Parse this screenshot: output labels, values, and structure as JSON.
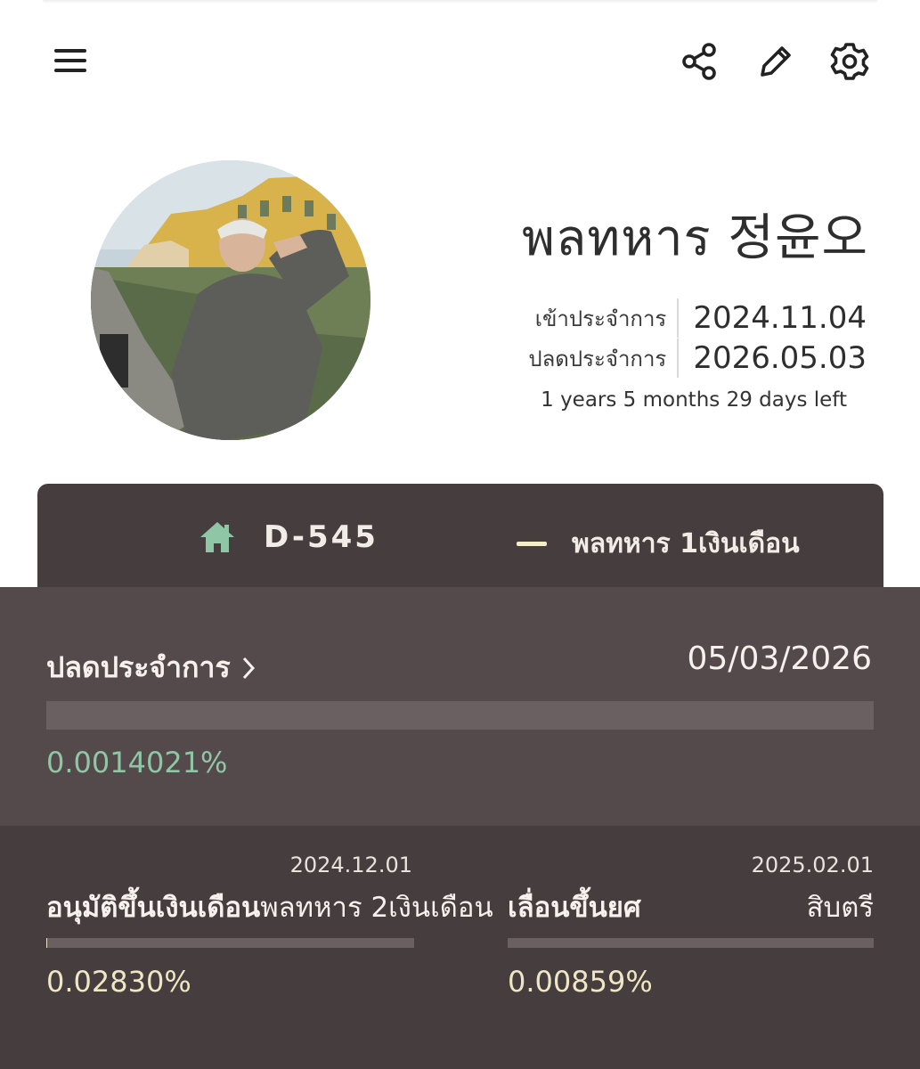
{
  "header": {
    "menu_icon": "hamburger-menu-icon",
    "share_icon": "share-icon",
    "edit_icon": "pencil-icon",
    "settings_icon": "gear-icon"
  },
  "profile": {
    "name": "พลทหาร 정윤오",
    "enlist_label": "เข้าประจำการ",
    "enlist_date": "2024.11.04",
    "discharge_label": "ปลดประจำการ",
    "discharge_date": "2026.05.03",
    "remaining": "1 years 5 months 29 days left"
  },
  "tabs": {
    "dday": "D-545",
    "rank": "พลทหาร 1เงินเดือน",
    "home_icon": "home-icon"
  },
  "discharge_progress": {
    "label": "ปลดประจำการ",
    "date": "05/03/2026",
    "percent_text": "0.0014021%",
    "progress_fraction": 1.4e-05,
    "accent": "#8fc7a6"
  },
  "salary": {
    "date": "2024.12.01",
    "title_bold": "อนุมัติขึ้นเงินเดือน",
    "title_rest": "พลทหาร 2เงินเดือน",
    "percent_text": "0.02830%",
    "progress_fraction": 0.000283
  },
  "promotion": {
    "date": "2025.02.01",
    "title": "เลื่อนขึ้นยศ",
    "rank": "สิบตรี",
    "percent_text": "0.00859%",
    "progress_fraction": 8.59e-05
  },
  "colors": {
    "card_dark": "#463d3e",
    "card_mid": "#544a4b",
    "green": "#8fc7a6",
    "cream": "#efe7c4"
  }
}
